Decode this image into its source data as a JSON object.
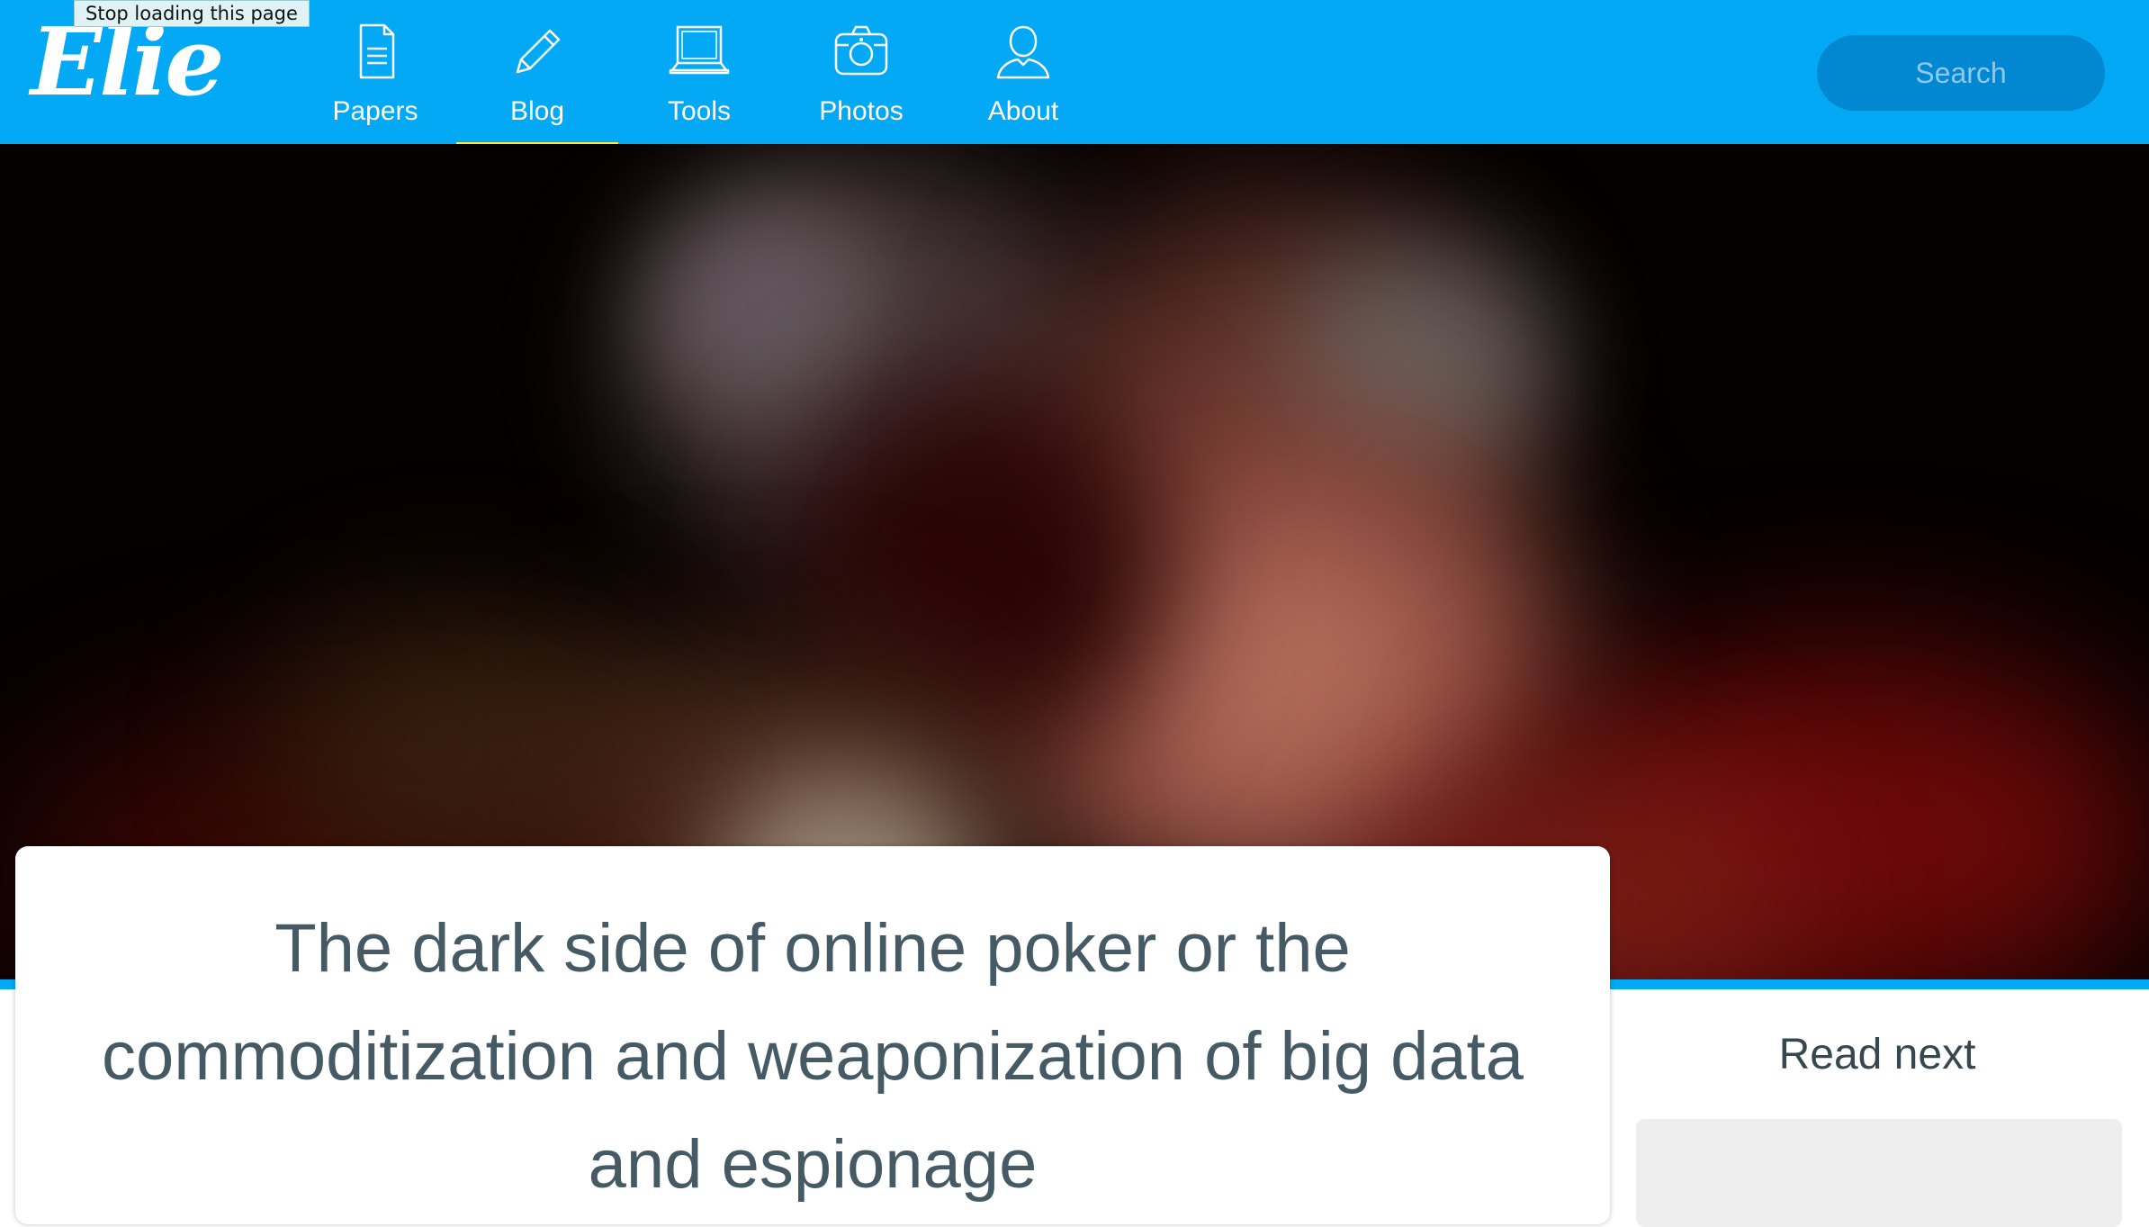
{
  "browser": {
    "tooltip": "Stop loading this page"
  },
  "header": {
    "logo": "Elie",
    "nav": [
      {
        "label": "Papers",
        "icon": "document-icon",
        "active": false
      },
      {
        "label": "Blog",
        "icon": "pencil-icon",
        "active": true
      },
      {
        "label": "Tools",
        "icon": "laptop-icon",
        "active": false
      },
      {
        "label": "Photos",
        "icon": "camera-icon",
        "active": false
      },
      {
        "label": "About",
        "icon": "user-icon",
        "active": false
      }
    ],
    "search_label": "Search"
  },
  "article": {
    "title": "The dark side of online poker or the commoditization and weaponization of big data and espionage"
  },
  "sidebar": {
    "read_next": "Read next"
  },
  "colors": {
    "header": "#03a9f4",
    "search_bg": "#0288d1",
    "active_underline": "#ffeb3b",
    "title_text": "#455a64"
  }
}
